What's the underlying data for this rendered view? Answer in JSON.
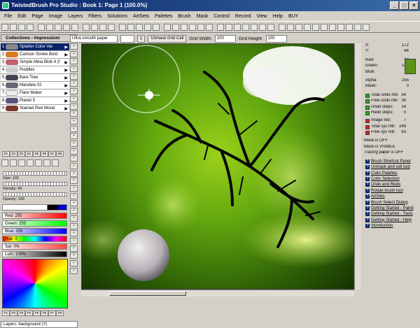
{
  "title": "TwistedBrush Pro Studio : Book 1: Page 1 (100.0%)",
  "window_buttons": [
    "_",
    "□",
    "×"
  ],
  "menu": [
    "File",
    "Edit",
    "Page",
    "Image",
    "Layers",
    "Filters",
    "Solutions",
    "ArtSets",
    "Palettes",
    "Brush",
    "Mask",
    "Control",
    "Record",
    "View",
    "Help",
    "BUY"
  ],
  "collections_title": "Collections - Impressioni",
  "brushes": [
    {
      "num": "1",
      "label": "Splatter Color Var",
      "color": "#888"
    },
    {
      "num": "2",
      "label": "Cartoon Stroke Bold",
      "color": "#d87a20"
    },
    {
      "num": "3",
      "label": "Simple Meta Blob 4 (f",
      "color": "#c06070"
    },
    {
      "num": "4",
      "label": "Puddles",
      "color": "#ccc"
    },
    {
      "num": "5",
      "label": "Bare Tree",
      "color": "#445"
    },
    {
      "num": "6",
      "label": "Mandala 02",
      "color": "#667"
    },
    {
      "num": "7",
      "label": "Flare Maker",
      "color": "#eee"
    },
    {
      "num": "8",
      "label": "Planet 5",
      "color": "#557"
    },
    {
      "num": "9",
      "label": "Stained Red Wood",
      "color": "#7a3a2a"
    }
  ],
  "brush_tabs": [
    "B1",
    "B2",
    "B3",
    "B4",
    "B5",
    "B6",
    "B7",
    "B8"
  ],
  "size_label": "Size: 102",
  "density_label": "Density: 40",
  "opacity_label": "Opacity: 100",
  "colors": {
    "red_label": "Red: 255",
    "green_label": "Green: 255",
    "blue_label": "Blue: 255",
    "hue_label": "Hue: 0",
    "sat_label": "Sat: 0%",
    "lum_label": "Lum: 100%"
  },
  "palette_tabs": [
    "P1",
    "P2",
    "P3",
    "P4",
    "P5",
    "P6",
    "P7",
    "P8"
  ],
  "layers_label": "Layers: background (Y)",
  "canvas_toolbar": {
    "paper": "Ultra smooth paper",
    "unmask_button": "Unmask Grid Cell",
    "grid_width_label": "Grid Width:",
    "grid_width_value": "100",
    "grid_height_label": "Grid Height:",
    "grid_height_value": "100"
  },
  "info": {
    "x_label": "X:",
    "x": "172",
    "y_label": "Y:",
    "y": "64",
    "red_label": "Red:",
    "red": "90",
    "green_label": "Green:",
    "green": "148",
    "blue_label": "Blue:",
    "blue": "10",
    "alpha_label": "Alpha:",
    "alpha": "255",
    "mask_label": "Mask:",
    "mask": "0",
    "stats": [
      {
        "k": "Total undo mb:",
        "v": "54",
        "c": "#2a2"
      },
      {
        "k": "Free undo mb:",
        "v": "39",
        "c": "#2a2"
      },
      {
        "k": "Undo steps:",
        "v": "14",
        "c": "#2a2"
      },
      {
        "k": "Redo steps:",
        "v": "0",
        "c": "#2a2"
      },
      {
        "k": "Image mb:",
        "v": "7",
        "c": "#c22"
      },
      {
        "k": "Total sys mb:",
        "v": "249",
        "c": "#c22"
      },
      {
        "k": "Free sys mb:",
        "v": "63",
        "c": "#c22"
      }
    ],
    "status": [
      "Mask is OFF",
      "Mask is VISIBLE",
      "Tracing paper is OFF"
    ],
    "help_links": [
      "Brush Shortcut Panel",
      "Unmask and cell tool",
      "Color Palettes",
      "Color Selection",
      "Undo and Redo",
      "Rotate brush tool",
      "ArtSets",
      "Brush Select Dialog",
      "Getting Started - Painti",
      "Getting Started - Tools",
      "Getting Started - Help",
      "Introduction"
    ]
  },
  "accent_color": "#0a246a",
  "current_color": "#5a9418"
}
